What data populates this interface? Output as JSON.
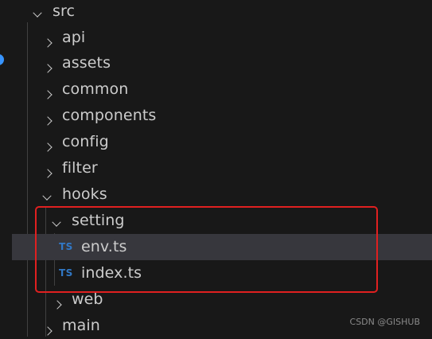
{
  "explorer": {
    "items": [
      {
        "label": "src",
        "type": "folder",
        "state": "expanded"
      },
      {
        "label": "api",
        "type": "folder",
        "state": "collapsed"
      },
      {
        "label": "assets",
        "type": "folder",
        "state": "collapsed"
      },
      {
        "label": "common",
        "type": "folder",
        "state": "collapsed"
      },
      {
        "label": "components",
        "type": "folder",
        "state": "collapsed"
      },
      {
        "label": "config",
        "type": "folder",
        "state": "collapsed"
      },
      {
        "label": "filter",
        "type": "folder",
        "state": "collapsed"
      },
      {
        "label": "hooks",
        "type": "folder",
        "state": "expanded"
      },
      {
        "label": "setting",
        "type": "folder",
        "state": "expanded"
      },
      {
        "label": "env.ts",
        "type": "file",
        "icon": "TS"
      },
      {
        "label": "index.ts",
        "type": "file",
        "icon": "TS"
      },
      {
        "label": "web",
        "type": "folder",
        "state": "collapsed"
      },
      {
        "label": "main",
        "type": "folder",
        "state": "collapsed"
      }
    ]
  },
  "colors": {
    "background": "#181818",
    "text": "#cccccc",
    "ts_icon": "#3178c6",
    "annotation_box": "#e02020",
    "selected_row": "#37373d"
  },
  "watermark": "CSDN @GISHUB"
}
